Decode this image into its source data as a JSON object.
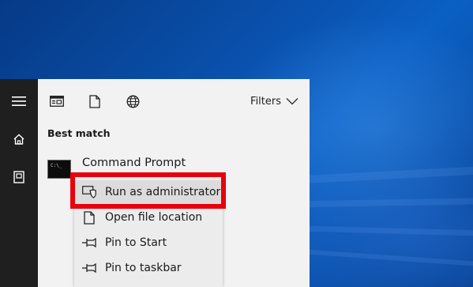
{
  "colors": {
    "highlight": "#e8000b",
    "rail_bg": "#1f1f1f",
    "panel_bg": "#f2f2f2",
    "menu_bg": "#ececec"
  },
  "rail": {
    "items": [
      {
        "icon": "hamburger-menu-icon"
      },
      {
        "icon": "home-icon"
      },
      {
        "icon": "documents-icon"
      }
    ]
  },
  "toolbar": {
    "icons": [
      "apps-icon",
      "documents-icon",
      "web-globe-icon"
    ],
    "filters_label": "Filters"
  },
  "results": {
    "section_title": "Best match",
    "top_result": {
      "title": "Command Prompt",
      "icon_text": "C:\\_"
    }
  },
  "context_menu": {
    "items": [
      {
        "label": "Run as administrator",
        "icon": "shield-icon",
        "highlighted": true
      },
      {
        "label": "Open file location",
        "icon": "folder-file-icon"
      },
      {
        "label": "Pin to Start",
        "icon": "pin-icon"
      },
      {
        "label": "Pin to taskbar",
        "icon": "pin-icon"
      }
    ]
  }
}
